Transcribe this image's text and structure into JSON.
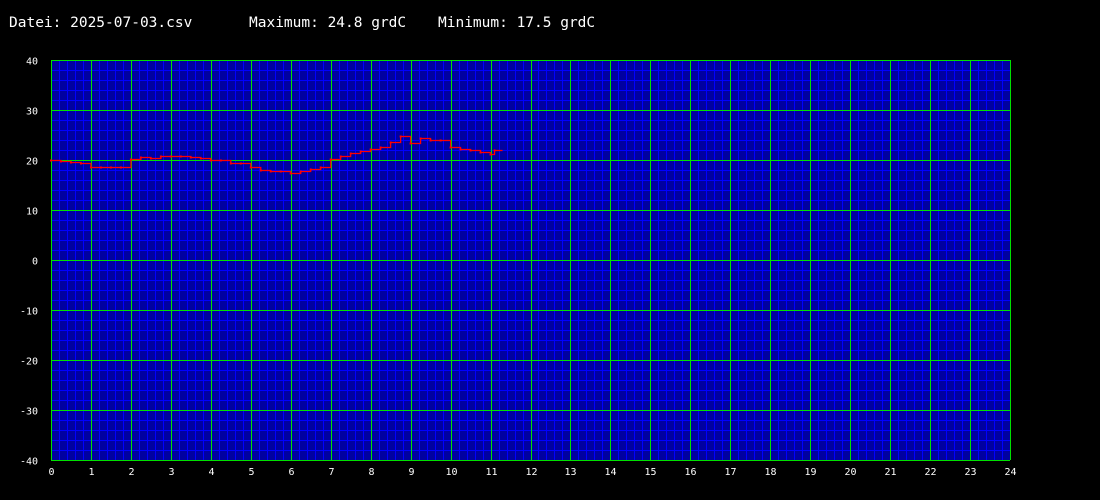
{
  "header": {
    "file": "Datei: 2025-07-03.csv",
    "maximum": "Maximum: 24.8 grdC",
    "minimum": "Minimum: 17.5 grdC"
  },
  "colors": {
    "background": "#000000",
    "plot_background": "#0000a0",
    "minor_grid": "#0000ff",
    "major_grid": "#00e000",
    "series": "#ff0000",
    "text": "#ffffff"
  },
  "chart_data": {
    "type": "line",
    "title": "",
    "xlabel": "",
    "ylabel": "",
    "xlim": [
      0,
      24
    ],
    "ylim": [
      -40,
      40
    ],
    "xticks": [
      0,
      1,
      2,
      3,
      4,
      5,
      6,
      7,
      8,
      9,
      10,
      11,
      12,
      13,
      14,
      15,
      16,
      17,
      18,
      19,
      20,
      21,
      22,
      23,
      24
    ],
    "yticks": [
      -40,
      -30,
      -20,
      -10,
      0,
      10,
      20,
      30,
      40
    ],
    "grid": true,
    "x_minor_step": 0.2,
    "y_minor_step": 2,
    "series": [
      {
        "x": [
          0,
          0.25,
          0.5,
          0.75,
          1,
          1.25,
          1.5,
          1.75,
          2,
          2.25,
          2.5,
          2.75,
          3,
          3.25,
          3.5,
          3.75,
          4,
          4.25,
          4.5,
          4.75,
          5,
          5.25,
          5.5,
          5.75,
          6,
          6.25,
          6.5,
          6.75,
          7,
          7.25,
          7.5,
          7.75,
          8,
          8.25,
          8.5,
          8.75,
          9,
          9.25,
          9.5,
          9.75,
          10,
          10.25,
          10.5,
          10.75,
          11,
          11.1
        ],
        "y": [
          20,
          19.8,
          19.6,
          19.4,
          18.6,
          18.6,
          18.6,
          18.6,
          20.2,
          20.6,
          20.4,
          20.8,
          20.8,
          20.8,
          20.6,
          20.4,
          20,
          20,
          19.4,
          19.4,
          18.6,
          18,
          17.8,
          17.8,
          17.5,
          17.8,
          18.2,
          18.6,
          20.2,
          20.8,
          21.4,
          21.8,
          22.2,
          22.6,
          23.6,
          24.8,
          23.4,
          24.4,
          24,
          24,
          22.6,
          22.2,
          22,
          21.6,
          21.2,
          22
        ]
      }
    ]
  }
}
